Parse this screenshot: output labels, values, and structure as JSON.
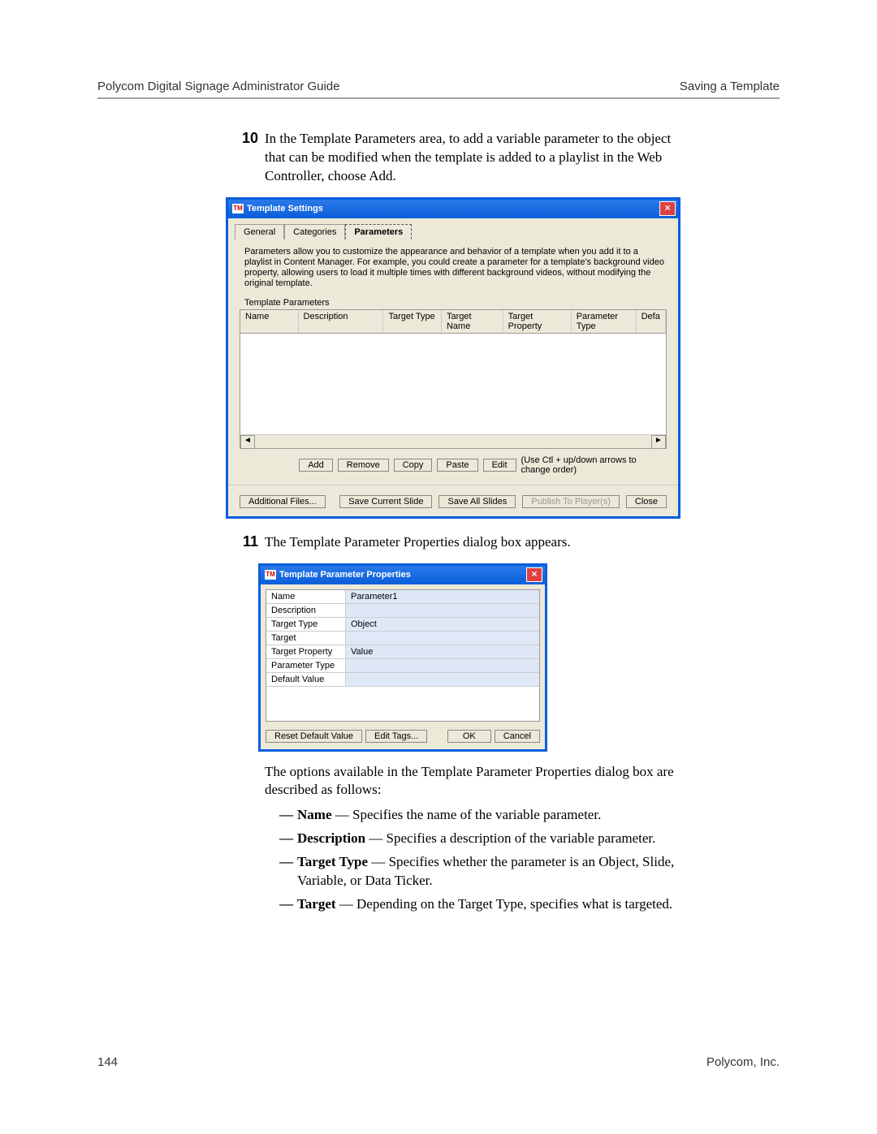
{
  "header": {
    "left": "Polycom Digital Signage Administrator Guide",
    "right": "Saving a Template"
  },
  "step10": {
    "num": "10",
    "text": "In the Template Parameters area, to add a variable parameter to the object that can be modified when the template is added to a playlist in the Web Controller, choose Add."
  },
  "dlg1": {
    "title": "Template Settings",
    "tabs": [
      "General",
      "Categories",
      "Parameters"
    ],
    "intro": "Parameters allow you to customize the appearance and behavior of a template when you add it to a playlist in Content Manager. For example, you could create a parameter for a template's background video property, allowing users to load it multiple times with different background videos, without modifying the original template.",
    "grpLabel": "Template Parameters",
    "cols": [
      "Name",
      "Description",
      "Target Type",
      "Target Name",
      "Target Property",
      "Parameter Type",
      "Defa"
    ],
    "btns": {
      "add": "Add",
      "remove": "Remove",
      "copy": "Copy",
      "paste": "Paste",
      "edit": "Edit",
      "hint": "(Use Ctl + up/down arrows to change order)"
    },
    "bottom": {
      "addfiles": "Additional Files...",
      "saveCurrent": "Save Current Slide",
      "saveAll": "Save All Slides",
      "publish": "Publish To Player(s)",
      "close": "Close"
    }
  },
  "step11": {
    "num": "11",
    "text": "The Template Parameter Properties dialog box appears."
  },
  "dlg2": {
    "title": "Template Parameter Properties",
    "rows": [
      {
        "l": "Name",
        "v": "Parameter1"
      },
      {
        "l": "Description",
        "v": ""
      },
      {
        "l": "Target Type",
        "v": "Object"
      },
      {
        "l": "Target",
        "v": ""
      },
      {
        "l": "Target Property",
        "v": "Value"
      },
      {
        "l": "Parameter Type",
        "v": ""
      },
      {
        "l": "Default Value",
        "v": ""
      }
    ],
    "btns": {
      "reset": "Reset Default Value",
      "tags": "Edit Tags...",
      "ok": "OK",
      "cancel": "Cancel"
    }
  },
  "desc": "The options available in the Template Parameter Properties dialog box are described as follows:",
  "bullets": [
    {
      "b": "Name",
      "t": " — Specifies the name of the variable parameter."
    },
    {
      "b": "Description",
      "t": " — Specifies a description of the variable parameter."
    },
    {
      "b": "Target Type",
      "t": " — Specifies whether the parameter is an Object, Slide, Variable, or Data Ticker."
    },
    {
      "b": "Target",
      "t": " — Depending on the Target Type, specifies what is targeted."
    }
  ],
  "footer": {
    "page": "144",
    "co": "Polycom, Inc."
  }
}
